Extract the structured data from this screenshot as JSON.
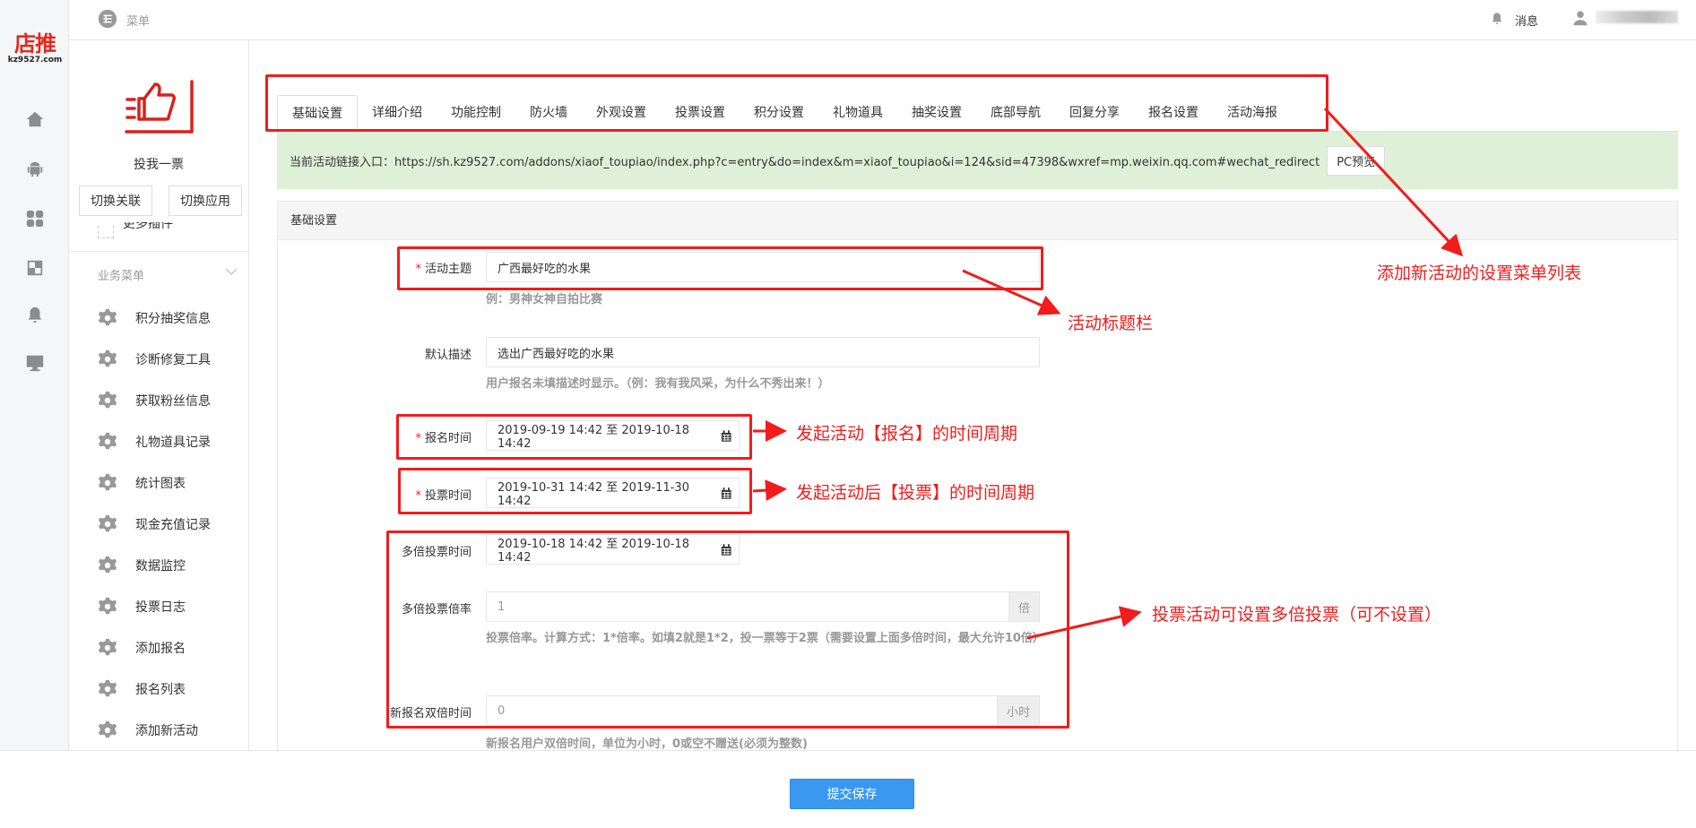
{
  "logo": {
    "cn": "店推",
    "en": "kz9527.com"
  },
  "topbar": {
    "menu_label": "菜单",
    "messages_label": "消息"
  },
  "app": {
    "name": "投我一票",
    "switch_link": "切换关联",
    "switch_app": "切换应用",
    "more_plugins": "更多插件"
  },
  "sidebar": {
    "section": "业务菜单",
    "items": [
      "积分抽奖信息",
      "诊断修复工具",
      "获取粉丝信息",
      "礼物道具记录",
      "统计图表",
      "现金充值记录",
      "数据监控",
      "投票日志",
      "添加报名",
      "报名列表",
      "添加新活动"
    ]
  },
  "tabs": [
    "基础设置",
    "详细介绍",
    "功能控制",
    "防火墙",
    "外观设置",
    "投票设置",
    "积分设置",
    "礼物道具",
    "抽奖设置",
    "底部导航",
    "回复分享",
    "报名设置",
    "活动海报"
  ],
  "linkbar": {
    "text": "当前活动链接入口：https://sh.kz9527.com/addons/xiaof_toupiao/index.php?c=entry&do=index&m=xiaof_toupiao&i=124&sid=47398&wxref=mp.weixin.qq.com#wechat_redirect",
    "preview": "PC预览"
  },
  "panel": {
    "title": "基础设置"
  },
  "form": {
    "subject": {
      "label": "活动主题",
      "value": "广西最好吃的水果",
      "hint": "例：男神女神自拍比赛"
    },
    "desc": {
      "label": "默认描述",
      "value": "选出广西最好吃的水果",
      "hint": "用户报名未填描述时显示。（例：我有我风采，为什么不秀出来！）"
    },
    "signup_time": {
      "label": "报名时间",
      "value": "2019-09-19 14:42 至 2019-10-18 14:42"
    },
    "vote_time": {
      "label": "投票时间",
      "value": "2019-10-31 14:42 至 2019-11-30 14:42"
    },
    "multi_time": {
      "label": "多倍投票时间",
      "value": "2019-10-18 14:42 至 2019-10-18 14:42"
    },
    "multi_rate": {
      "label": "多倍投票倍率",
      "value": "1",
      "unit": "倍",
      "hint": "投票倍率。计算方式：1*倍率。如填2就是1*2，投一票等于2票（需要设置上面多倍时间，最大允许10倍）"
    },
    "new_double": {
      "label": "新报名双倍时间",
      "value": "0",
      "unit": "小时",
      "hint": "新报名用户双倍时间，单位为小时，0或空不赠送(必须为整数)"
    }
  },
  "footer": {
    "save": "提交保存"
  },
  "annotations": {
    "tabs": "添加新活动的设置菜单列表",
    "title": "活动标题栏",
    "signup": "发起活动【报名】的时间周期",
    "vote": "发起活动后【投票】的时间周期",
    "multi": "投票活动可设置多倍投票（可不设置）"
  },
  "colors": {
    "accent": "#3a98f0",
    "annotation": "#f21c1c",
    "linkbar": "#dff0d8"
  }
}
